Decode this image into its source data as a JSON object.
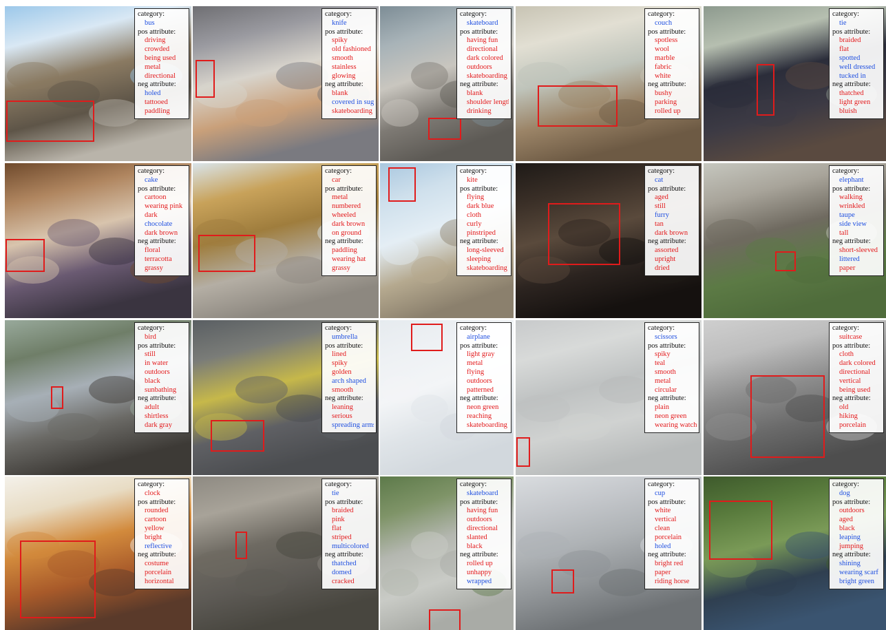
{
  "colors": {
    "positive": "#e31a1c",
    "negative_match": "#1f4fe0",
    "box": "#e01b1b"
  },
  "labels": {
    "category": "category:",
    "pos": "pos attribute:",
    "neg": "neg attribute:"
  },
  "tiles": [
    {
      "scene": "street-bus",
      "category": {
        "text": "bus",
        "color": "blue"
      },
      "pos": [
        {
          "text": "driving",
          "color": "red"
        },
        {
          "text": "crowded",
          "color": "red"
        },
        {
          "text": "being used",
          "color": "red"
        },
        {
          "text": "metal",
          "color": "red"
        },
        {
          "text": "directional",
          "color": "red"
        }
      ],
      "neg": [
        {
          "text": "holed",
          "color": "blue"
        },
        {
          "text": "tattooed",
          "color": "red"
        },
        {
          "text": "paddling",
          "color": "red"
        }
      ]
    },
    {
      "scene": "table-knife",
      "category": {
        "text": "knife",
        "color": "blue"
      },
      "pos": [
        {
          "text": "spiky",
          "color": "red"
        },
        {
          "text": "old fashioned",
          "color": "red"
        },
        {
          "text": "smooth",
          "color": "red"
        },
        {
          "text": "stainless",
          "color": "red"
        },
        {
          "text": "glowing",
          "color": "red"
        }
      ],
      "neg": [
        {
          "text": "blank",
          "color": "red"
        },
        {
          "text": "covered in sugar",
          "color": "blue"
        },
        {
          "text": "skateboarding",
          "color": "red"
        }
      ]
    },
    {
      "scene": "plaza-skateboard",
      "category": {
        "text": "skateboard",
        "color": "blue"
      },
      "pos": [
        {
          "text": "having fun",
          "color": "red"
        },
        {
          "text": "directional",
          "color": "red"
        },
        {
          "text": "dark colored",
          "color": "red"
        },
        {
          "text": "outdoors",
          "color": "red"
        },
        {
          "text": "skateboarding",
          "color": "red"
        }
      ],
      "neg": [
        {
          "text": "blank",
          "color": "red"
        },
        {
          "text": "shoulder length",
          "color": "red"
        },
        {
          "text": "drinking",
          "color": "red"
        }
      ]
    },
    {
      "scene": "room-couch",
      "category": {
        "text": "couch",
        "color": "blue"
      },
      "pos": [
        {
          "text": "spotless",
          "color": "red"
        },
        {
          "text": "wool",
          "color": "red"
        },
        {
          "text": "marble",
          "color": "red"
        },
        {
          "text": "fabric",
          "color": "red"
        },
        {
          "text": "white",
          "color": "red"
        }
      ],
      "neg": [
        {
          "text": "bushy",
          "color": "red"
        },
        {
          "text": "parking",
          "color": "red"
        },
        {
          "text": "rolled up",
          "color": "red"
        }
      ]
    },
    {
      "scene": "people-tie",
      "category": {
        "text": "tie",
        "color": "blue"
      },
      "pos": [
        {
          "text": "braided",
          "color": "red"
        },
        {
          "text": "flat",
          "color": "red"
        },
        {
          "text": "spotted",
          "color": "blue"
        },
        {
          "text": "well dressed",
          "color": "blue"
        },
        {
          "text": "tucked in",
          "color": "blue"
        }
      ],
      "neg": [
        {
          "text": "thatched",
          "color": "red"
        },
        {
          "text": "light green",
          "color": "red"
        },
        {
          "text": "bluish",
          "color": "red"
        }
      ]
    },
    {
      "scene": "bakery-cake",
      "category": {
        "text": "cake",
        "color": "blue"
      },
      "pos": [
        {
          "text": "cartoon",
          "color": "red"
        },
        {
          "text": "wearing pink",
          "color": "red"
        },
        {
          "text": "dark",
          "color": "red"
        },
        {
          "text": "chocolate",
          "color": "blue"
        },
        {
          "text": "dark brown",
          "color": "red"
        }
      ],
      "neg": [
        {
          "text": "floral",
          "color": "red"
        },
        {
          "text": "terracotta",
          "color": "red"
        },
        {
          "text": "grassy",
          "color": "red"
        }
      ]
    },
    {
      "scene": "sidewalk-car",
      "category": {
        "text": "car",
        "color": "red"
      },
      "pos": [
        {
          "text": "metal",
          "color": "red"
        },
        {
          "text": "numbered",
          "color": "red"
        },
        {
          "text": "wheeled",
          "color": "red"
        },
        {
          "text": "dark brown",
          "color": "red"
        },
        {
          "text": "on ground",
          "color": "red"
        }
      ],
      "neg": [
        {
          "text": "paddling",
          "color": "red"
        },
        {
          "text": "wearing hat",
          "color": "red"
        },
        {
          "text": "grassy",
          "color": "red"
        }
      ]
    },
    {
      "scene": "beach-kite",
      "category": {
        "text": "kite",
        "color": "red"
      },
      "pos": [
        {
          "text": "flying",
          "color": "red"
        },
        {
          "text": "dark blue",
          "color": "red"
        },
        {
          "text": "cloth",
          "color": "red"
        },
        {
          "text": "curly",
          "color": "red"
        },
        {
          "text": "pinstriped",
          "color": "red"
        }
      ],
      "neg": [
        {
          "text": "long-sleeved",
          "color": "red"
        },
        {
          "text": "sleeping",
          "color": "red"
        },
        {
          "text": "skateboarding",
          "color": "red"
        }
      ]
    },
    {
      "scene": "dark-cat",
      "category": {
        "text": "cat",
        "color": "blue"
      },
      "pos": [
        {
          "text": "aged",
          "color": "red"
        },
        {
          "text": "still",
          "color": "red"
        },
        {
          "text": "furry",
          "color": "blue"
        },
        {
          "text": "tan",
          "color": "red"
        },
        {
          "text": "dark brown",
          "color": "red"
        }
      ],
      "neg": [
        {
          "text": "assorted",
          "color": "red"
        },
        {
          "text": "upright",
          "color": "red"
        },
        {
          "text": "dried",
          "color": "red"
        }
      ]
    },
    {
      "scene": "shed-elephant",
      "category": {
        "text": "elephant",
        "color": "blue"
      },
      "pos": [
        {
          "text": "walking",
          "color": "red"
        },
        {
          "text": "wrinkled",
          "color": "red"
        },
        {
          "text": "taupe",
          "color": "blue"
        },
        {
          "text": "side view",
          "color": "blue"
        },
        {
          "text": "tall",
          "color": "red"
        }
      ],
      "neg": [
        {
          "text": "short-sleeved",
          "color": "red"
        },
        {
          "text": "littered",
          "color": "blue"
        },
        {
          "text": "paper",
          "color": "red"
        }
      ]
    },
    {
      "scene": "river-bird",
      "category": {
        "text": "bird",
        "color": "red"
      },
      "pos": [
        {
          "text": "still",
          "color": "red"
        },
        {
          "text": "in water",
          "color": "red"
        },
        {
          "text": "outdoors",
          "color": "red"
        },
        {
          "text": "black",
          "color": "red"
        },
        {
          "text": "sunbathing",
          "color": "red"
        }
      ],
      "neg": [
        {
          "text": "adult",
          "color": "red"
        },
        {
          "text": "shirtless",
          "color": "red"
        },
        {
          "text": "dark gray",
          "color": "red"
        }
      ]
    },
    {
      "scene": "crosswalk-umbrella",
      "category": {
        "text": "umbrella",
        "color": "blue"
      },
      "pos": [
        {
          "text": "lined",
          "color": "red"
        },
        {
          "text": "spiky",
          "color": "red"
        },
        {
          "text": "golden",
          "color": "red"
        },
        {
          "text": "arch shaped",
          "color": "blue"
        },
        {
          "text": "smooth",
          "color": "red"
        }
      ],
      "neg": [
        {
          "text": "leaning",
          "color": "red"
        },
        {
          "text": "serious",
          "color": "red"
        },
        {
          "text": "spreading arms",
          "color": "blue"
        }
      ]
    },
    {
      "scene": "sky-airplane",
      "category": {
        "text": "airplane",
        "color": "blue"
      },
      "pos": [
        {
          "text": "light gray",
          "color": "red"
        },
        {
          "text": "metal",
          "color": "red"
        },
        {
          "text": "flying",
          "color": "red"
        },
        {
          "text": "outdoors",
          "color": "red"
        },
        {
          "text": "patterned",
          "color": "red"
        }
      ],
      "neg": [
        {
          "text": "neon green",
          "color": "red"
        },
        {
          "text": "reaching",
          "color": "red"
        },
        {
          "text": "skateboarding",
          "color": "red"
        }
      ]
    },
    {
      "scene": "floor-scissors",
      "category": {
        "text": "scissors",
        "color": "blue"
      },
      "pos": [
        {
          "text": "spiky",
          "color": "red"
        },
        {
          "text": "teal",
          "color": "red"
        },
        {
          "text": "smooth",
          "color": "red"
        },
        {
          "text": "metal",
          "color": "red"
        },
        {
          "text": "circular",
          "color": "red"
        }
      ],
      "neg": [
        {
          "text": "plain",
          "color": "red"
        },
        {
          "text": "neon green",
          "color": "red"
        },
        {
          "text": "wearing watch",
          "color": "red"
        }
      ]
    },
    {
      "scene": "gray-suitcase",
      "category": {
        "text": "suitcase",
        "color": "red"
      },
      "pos": [
        {
          "text": "cloth",
          "color": "red"
        },
        {
          "text": "dark colored",
          "color": "red"
        },
        {
          "text": "directional",
          "color": "red"
        },
        {
          "text": "vertical",
          "color": "red"
        },
        {
          "text": "being used",
          "color": "red"
        }
      ],
      "neg": [
        {
          "text": "old",
          "color": "red"
        },
        {
          "text": "hiking",
          "color": "red"
        },
        {
          "text": "porcelain",
          "color": "red"
        }
      ]
    },
    {
      "scene": "art-clock",
      "category": {
        "text": "clock",
        "color": "red"
      },
      "pos": [
        {
          "text": "rounded",
          "color": "red"
        },
        {
          "text": "cartoon",
          "color": "red"
        },
        {
          "text": "yellow",
          "color": "red"
        },
        {
          "text": "bright",
          "color": "red"
        },
        {
          "text": "reflective",
          "color": "blue"
        }
      ],
      "neg": [
        {
          "text": "costume",
          "color": "red"
        },
        {
          "text": "porcelain",
          "color": "red"
        },
        {
          "text": "horizontal",
          "color": "red"
        }
      ]
    },
    {
      "scene": "boy-tie",
      "category": {
        "text": "tie",
        "color": "blue"
      },
      "pos": [
        {
          "text": "braided",
          "color": "red"
        },
        {
          "text": "pink",
          "color": "red"
        },
        {
          "text": "flat",
          "color": "red"
        },
        {
          "text": "striped",
          "color": "red"
        },
        {
          "text": "multicolored",
          "color": "blue"
        }
      ],
      "neg": [
        {
          "text": "thatched",
          "color": "blue"
        },
        {
          "text": "domed",
          "color": "blue"
        },
        {
          "text": "cracked",
          "color": "red"
        }
      ]
    },
    {
      "scene": "park-skateboard",
      "category": {
        "text": "skateboard",
        "color": "blue"
      },
      "pos": [
        {
          "text": "having fun",
          "color": "red"
        },
        {
          "text": "outdoors",
          "color": "red"
        },
        {
          "text": "directional",
          "color": "red"
        },
        {
          "text": "slanted",
          "color": "red"
        },
        {
          "text": "black",
          "color": "red"
        }
      ],
      "neg": [
        {
          "text": "rolled up",
          "color": "red"
        },
        {
          "text": "unhappy",
          "color": "red"
        },
        {
          "text": "wrapped",
          "color": "blue"
        }
      ]
    },
    {
      "scene": "office-cup",
      "category": {
        "text": "cup",
        "color": "blue"
      },
      "pos": [
        {
          "text": "white",
          "color": "red"
        },
        {
          "text": "vertical",
          "color": "red"
        },
        {
          "text": "clean",
          "color": "red"
        },
        {
          "text": "porcelain",
          "color": "red"
        },
        {
          "text": "holed",
          "color": "blue"
        }
      ],
      "neg": [
        {
          "text": "bright red",
          "color": "red"
        },
        {
          "text": "paper",
          "color": "red"
        },
        {
          "text": "riding horse",
          "color": "red"
        }
      ]
    },
    {
      "scene": "trees-dog",
      "category": {
        "text": "dog",
        "color": "blue"
      },
      "pos": [
        {
          "text": "outdoors",
          "color": "red"
        },
        {
          "text": "aged",
          "color": "red"
        },
        {
          "text": "black",
          "color": "red"
        },
        {
          "text": "leaping",
          "color": "blue"
        },
        {
          "text": "jumping",
          "color": "red"
        }
      ],
      "neg": [
        {
          "text": "shining",
          "color": "blue"
        },
        {
          "text": "wearing scarf",
          "color": "blue"
        },
        {
          "text": "bright green",
          "color": "blue"
        }
      ]
    }
  ]
}
